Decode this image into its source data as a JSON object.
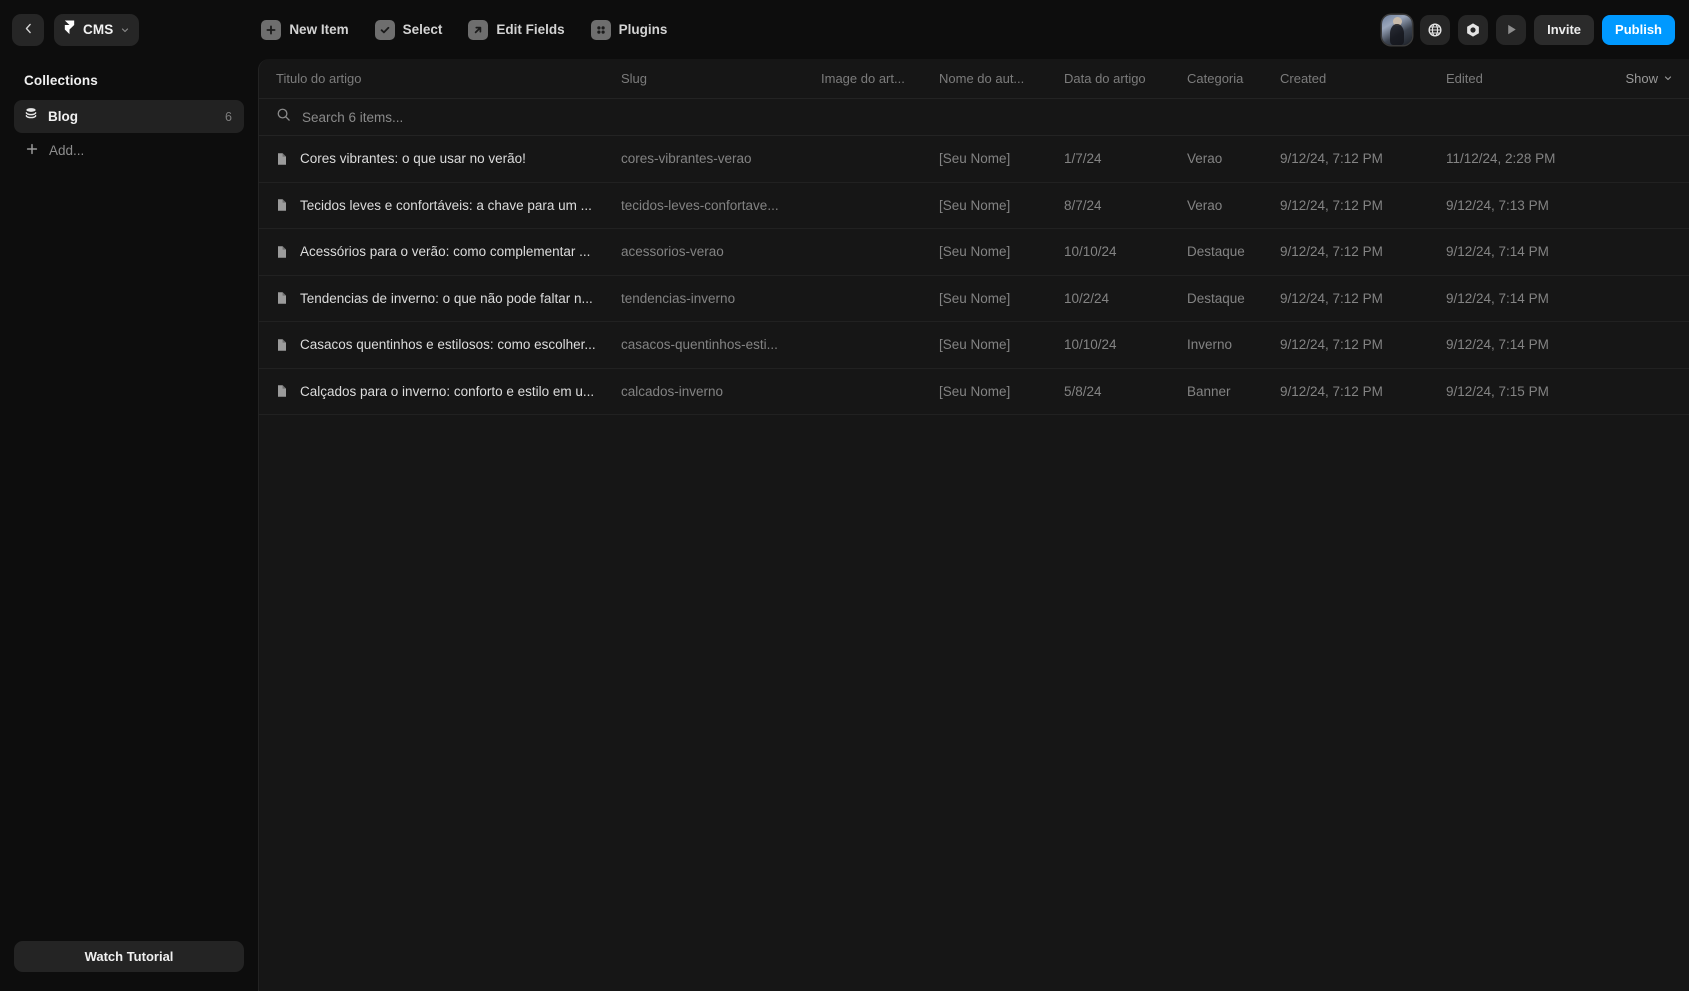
{
  "topbar": {
    "back_icon": "chevron-left-icon",
    "project": {
      "logo": "framer-logo-icon",
      "name": "CMS",
      "chevron": "chevron-down-icon"
    },
    "tools": [
      {
        "label": "New Item",
        "icon": "plus-square-icon"
      },
      {
        "label": "Select",
        "icon": "check-square-icon"
      },
      {
        "label": "Edit Fields",
        "icon": "arrow-up-right-square-icon"
      },
      {
        "label": "Plugins",
        "icon": "plugins-grid-icon"
      }
    ],
    "avatar": "user-avatar",
    "globe_icon": "globe-icon",
    "record_icon": "record-circle-icon",
    "preview_icon": "play-triangle-icon",
    "invite_label": "Invite",
    "publish_label": "Publish",
    "publish_color": "#0099ff"
  },
  "sidebar": {
    "title": "Collections",
    "items": [
      {
        "label": "Blog",
        "count": "6",
        "icon": "database-stack-icon",
        "active": true
      }
    ],
    "add_label": "Add...",
    "add_icon": "plus-icon",
    "tutorial_label": "Watch Tutorial"
  },
  "table": {
    "columns": [
      {
        "key": "title",
        "label": "Titulo do artigo"
      },
      {
        "key": "slug",
        "label": "Slug"
      },
      {
        "key": "image",
        "label": "Image do art..."
      },
      {
        "key": "author",
        "label": "Nome do aut..."
      },
      {
        "key": "date",
        "label": "Data do artigo"
      },
      {
        "key": "cat",
        "label": "Categoria"
      },
      {
        "key": "created",
        "label": "Created"
      },
      {
        "key": "edited",
        "label": "Edited"
      }
    ],
    "show_label": "Show",
    "show_chevron": "chevron-down-icon",
    "search": {
      "placeholder": "Search 6 items...",
      "value": "",
      "icon": "search-icon"
    },
    "rows": [
      {
        "title": "Cores vibrantes: o que usar no verão!",
        "slug": "cores-vibrantes-verao",
        "author": "[Seu Nome]",
        "date": "1/7/24",
        "cat": "Verao",
        "created": "9/12/24, 7:12 PM",
        "edited": "11/12/24, 2:28 PM",
        "thumb_a": "#cfc6bb",
        "thumb_b": "#6d6257"
      },
      {
        "title": "Tecidos leves e confortáveis: a chave para um ...",
        "slug": "tecidos-leves-confortave...",
        "author": "[Seu Nome]",
        "date": "8/7/24",
        "cat": "Verao",
        "created": "9/12/24, 7:12 PM",
        "edited": "9/12/24, 7:13 PM",
        "thumb_a": "#9fb6c9",
        "thumb_b": "#2c4358"
      },
      {
        "title": "Acessórios para o verão: como complementar ...",
        "slug": "acessorios-verao",
        "author": "[Seu Nome]",
        "date": "10/10/24",
        "cat": "Destaque",
        "created": "9/12/24, 7:12 PM",
        "edited": "9/12/24, 7:14 PM",
        "thumb_a": "#3f8f86",
        "thumb_b": "#d8d2c6"
      },
      {
        "title": "Tendencias de inverno: o que não pode faltar n...",
        "slug": "tendencias-inverno",
        "author": "[Seu Nome]",
        "date": "10/2/24",
        "cat": "Destaque",
        "created": "9/12/24, 7:12 PM",
        "edited": "9/12/24, 7:14 PM",
        "thumb_a": "#d7cbb6",
        "thumb_b": "#41372c"
      },
      {
        "title": "Casacos quentinhos e estilosos: como escolher...",
        "slug": "casacos-quentinhos-esti...",
        "author": "[Seu Nome]",
        "date": "10/10/24",
        "cat": "Inverno",
        "created": "9/12/24, 7:12 PM",
        "edited": "9/12/24, 7:14 PM",
        "thumb_a": "#e8e4df",
        "thumb_b": "#1d1b1a"
      },
      {
        "title": "Calçados para o inverno: conforto e estilo em u...",
        "slug": "calcados-inverno",
        "author": "[Seu Nome]",
        "date": "5/8/24",
        "cat": "Banner",
        "created": "9/12/24, 7:12 PM",
        "edited": "9/12/24, 7:15 PM",
        "thumb_a": "#e8604f",
        "thumb_b": "#7a1410"
      }
    ]
  }
}
